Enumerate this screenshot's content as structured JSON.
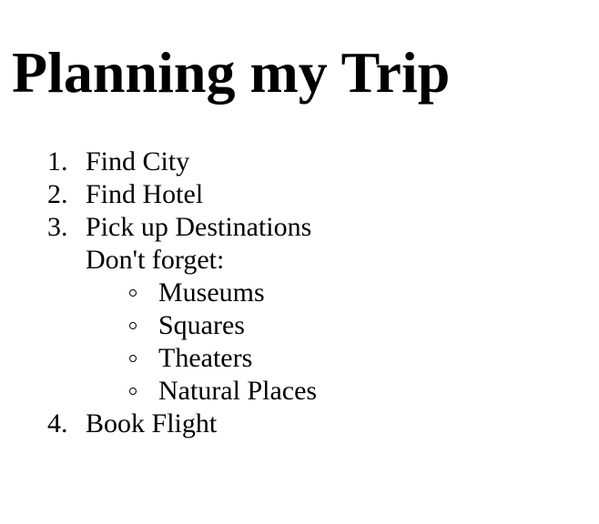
{
  "page": {
    "title": "Planning my Trip"
  },
  "steps": [
    {
      "number": "1.",
      "label": "Find City"
    },
    {
      "number": "2.",
      "label": "Find Hotel"
    },
    {
      "number": "3.",
      "label": "Pick up Destinations",
      "note": "Don't forget:",
      "subitems": [
        "Museums",
        "Squares",
        "Theaters",
        "Natural Places"
      ]
    },
    {
      "number": "4.",
      "label": "Book Flight"
    }
  ]
}
